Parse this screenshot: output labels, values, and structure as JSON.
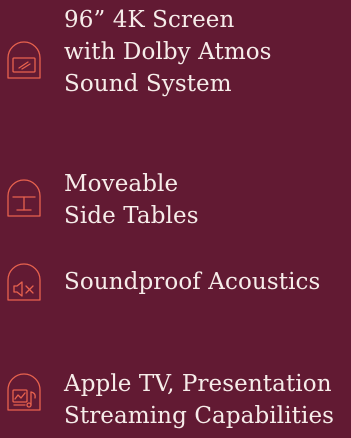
{
  "features": [
    {
      "icon": "screen-icon",
      "lines": [
        "96” 4K Screen",
        "with Dolby Atmos",
        "Sound System"
      ]
    },
    {
      "icon": "table-icon",
      "lines": [
        "Moveable",
        "Side Tables"
      ]
    },
    {
      "icon": "speaker-mute-icon",
      "lines": [
        "Soundproof Acoustics"
      ]
    },
    {
      "icon": "streaming-icon",
      "lines": [
        "Apple TV, Presentation",
        "Streaming Capabilities"
      ]
    }
  ],
  "colors": {
    "background": "#621a33",
    "accent": "#e8624e",
    "text": "#f6ece9"
  }
}
